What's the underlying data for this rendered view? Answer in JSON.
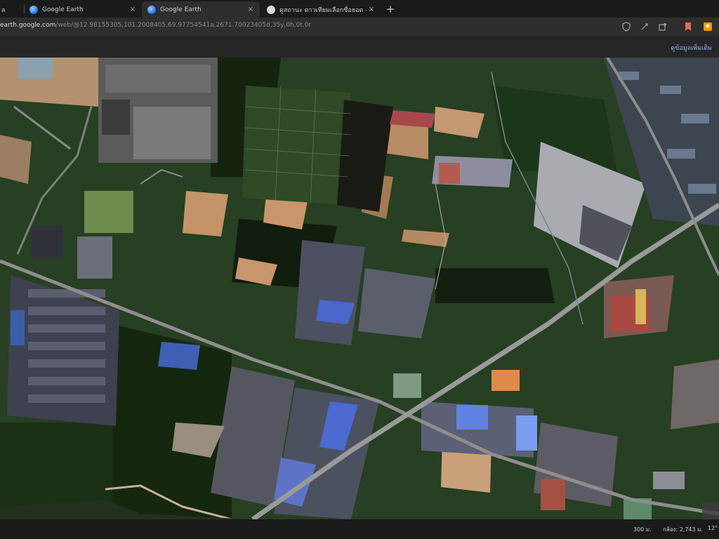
{
  "tabs": [
    {
      "title": "ล",
      "active": false,
      "close": "×"
    },
    {
      "title": "Google Earth",
      "active": false,
      "close": "×"
    },
    {
      "title": "Google Earth",
      "active": true,
      "close": "×"
    },
    {
      "title": "ดูสถานะ ดาวเทียมเลือกชื่อยอด - ดินทาขาว",
      "active": false,
      "close": "×"
    }
  ],
  "new_tab": "+",
  "address": {
    "host": "earth.google.com",
    "path": "/web/@12.98155305,101.2008405,69.97754541a,2671.70023405d,35y,0h,0t,0r"
  },
  "toolbar_icons": [
    "shield-icon",
    "extension-icon",
    "puzzle-icon",
    "bookmark-icon",
    "profile-icon"
  ],
  "earth": {
    "top_right_link": "ดูข้อมูลเพิ่มเติม"
  },
  "status_bar": {
    "scale": "300 ม.",
    "camera": "กล้อง: 2,743 ม.",
    "coords": "12°"
  },
  "colors": {
    "accent": "#8ab4f8",
    "road": "#8e8e8e",
    "vegetation": "#1f3a1c"
  }
}
